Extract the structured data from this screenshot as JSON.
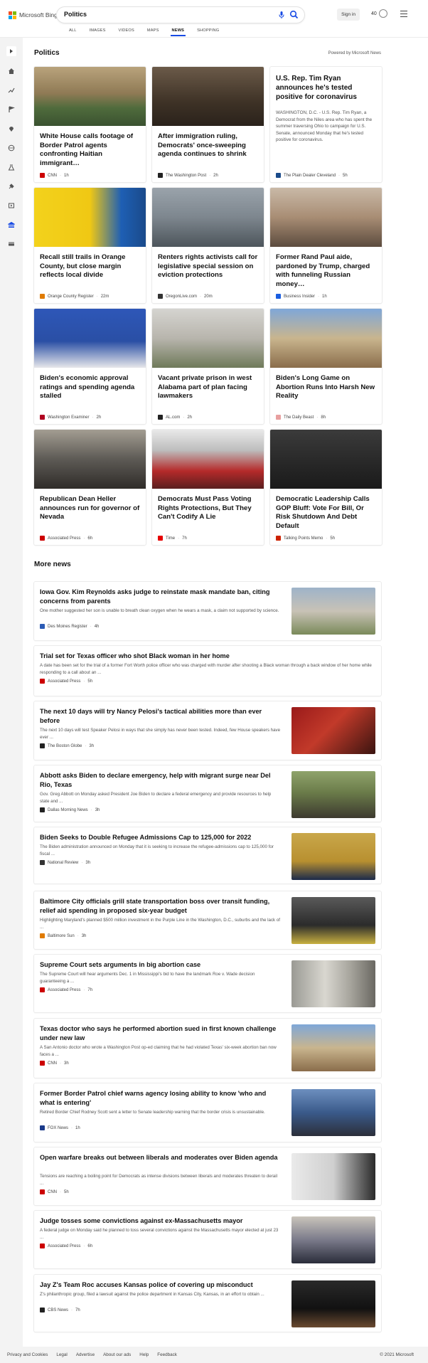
{
  "header": {
    "brand": "Microsoft Bing",
    "query": "Politics",
    "sign_in": "Sign in",
    "rewards_points": "40",
    "icons": [
      "microphone-icon",
      "search-icon",
      "rewards-medal-icon",
      "hamburger-menu-icon"
    ],
    "tabs": [
      {
        "label": "ALL",
        "active": false
      },
      {
        "label": "IMAGES",
        "active": false
      },
      {
        "label": "VIDEOS",
        "active": false
      },
      {
        "label": "MAPS",
        "active": false
      },
      {
        "label": "NEWS",
        "active": true
      },
      {
        "label": "SHOPPING",
        "active": false
      }
    ],
    "colors": {
      "accent": "#174ae4",
      "ms_red": "#f25022",
      "ms_green": "#7fba00",
      "ms_blue": "#00a4ef",
      "ms_yellow": "#ffb900"
    }
  },
  "sidebar": {
    "icons": [
      "expand-icon",
      "home-icon",
      "trending-icon",
      "flag-icon",
      "location-icon",
      "world-icon",
      "science-icon",
      "sports-icon",
      "entertainment-icon",
      "politics-icon",
      "money-icon"
    ]
  },
  "section": {
    "title": "Politics",
    "powered_by": "Powered by Microsoft News"
  },
  "cards": [
    {
      "title": "White House calls footage of Border Patrol agents confronting Haitian immigrant…",
      "source": "CNN",
      "time": "1h",
      "favicon_color": "#cc0000",
      "image": "border-patrol-horse-photo"
    },
    {
      "title": "After immigration ruling, Democrats' once-sweeping agenda continues to shrink",
      "source": "The Washington Post",
      "time": "2h",
      "favicon_color": "#222222",
      "image": "senators-hallway-photo"
    },
    {
      "title": "U.S. Rep. Tim Ryan announces he's tested positive for coronavirus",
      "snippet": "WASHINGTON, D.C. - U.S. Rep. Tim Ryan, a Democrat from the Niles area who has spent the summer traversing Ohio to campaign for U.S. Senate, announced Monday that he's tested positive for coronavirus.",
      "source": "The Plain Dealer Cleveland",
      "time": "5h",
      "favicon_color": "#1a4a8a"
    },
    {
      "title": "Recall still trails in Orange County, but close margin reflects local divide",
      "source": "Orange County Register",
      "time": "22m",
      "favicon_color": "#e07b00",
      "image": "ballot-drop-box-photo"
    },
    {
      "title": "Renters rights activists call for legislative special session on eviction protections",
      "source": "OregonLive.com",
      "time": "20m",
      "favicon_color": "#333333",
      "image": "capitol-dome-photo"
    },
    {
      "title": "Former Rand Paul aide, pardoned by Trump, charged with funneling Russian money…",
      "source": "Business Insider",
      "time": "1h",
      "favicon_color": "#1a5ee0",
      "image": "aide-portrait-photo"
    },
    {
      "title": "Biden's economic approval ratings and spending agenda stalled",
      "source": "Washington Examiner",
      "time": "2h",
      "favicon_color": "#b00020",
      "image": "pelosi-biden-podium-photo"
    },
    {
      "title": "Vacant private prison in west Alabama part of plan facing lawmakers",
      "source": "AL.com",
      "time": "2h",
      "favicon_color": "#222222",
      "image": "pardons-paroles-sign-photo"
    },
    {
      "title": "Biden's Long Game on Abortion Runs Into Harsh New Reality",
      "source": "The Daily Beast",
      "time": "8h",
      "favicon_color": "#e8a0a0",
      "image": "texas-protest-photo"
    },
    {
      "title": "Republican Dean Heller announces run for governor of Nevada",
      "source": "Associated Press",
      "time": "6h",
      "favicon_color": "#cc0000",
      "image": "heller-rally-photo"
    },
    {
      "title": "Democrats Must Pass Voting Rights Protections, But They Can't Codify A Lie",
      "source": "Time",
      "time": "7h",
      "favicon_color": "#e60000",
      "image": "voting-rights-rally-photo"
    },
    {
      "title": "Democratic Leadership Calls GOP Bluff: Vote For Bill, Or Risk Shutdown And Debt Default",
      "source": "Talking Points Memo",
      "time": "5h",
      "favicon_color": "#cc2200",
      "image": "democratic-leaders-photo"
    }
  ],
  "more_news": {
    "title": "More news",
    "items": [
      {
        "title": "Iowa Gov. Kim Reynolds asks judge to reinstate mask mandate ban, citing concerns from parents",
        "snippet": "One mother suggested her son is unable to breath clean oxygen when he wears a mask, a claim not supported by science.",
        "source": "Des Moines Register",
        "time": "4h",
        "favicon_color": "#2b5bb5",
        "has_thumb": true
      },
      {
        "title": "Trial set for Texas officer who shot Black woman in her home",
        "snippet": "A date has been set for the trial of a former Fort Worth police officer who was charged with murder after shooting a Black woman through a back window of her home while responding to a call about an ...",
        "source": "Associated Press",
        "time": "5h",
        "favicon_color": "#cc0000",
        "has_thumb": false
      },
      {
        "title": "The next 10 days will try Nancy Pelosi's tactical abilities more than ever before",
        "snippet": "The next 10 days will test Speaker Pelosi in ways that she simply has never been tested. Indeed, few House speakers have ever ...",
        "source": "The Boston Globe",
        "time": "3h",
        "favicon_color": "#222222",
        "has_thumb": true
      },
      {
        "title": "Abbott asks Biden to declare emergency, help with migrant surge near Del Rio, Texas",
        "snippet": "Gov. Greg Abbott on Monday asked President Joe Biden to declare a federal emergency and provide resources to help state and ...",
        "source": "Dallas Morning News",
        "time": "3h",
        "favicon_color": "#222222",
        "has_thumb": true
      },
      {
        "title": "Biden Seeks to Double Refugee Admissions Cap to 125,000 for 2022",
        "snippet": "The Biden administration announced on Monday that it is seeking to increase the refugee-admissions cap to 125,000 for fiscal ...",
        "source": "National Review",
        "time": "3h",
        "favicon_color": "#333333",
        "has_thumb": true
      },
      {
        "title": "Baltimore City officials grill state transportation boss over transit funding, relief aid spending in proposed six-year budget",
        "snippet": "Highlighting Maryland's planned $500 million investment in the Purple Line in the Washington, D.C., suburbs and the lack of ...",
        "source": "Baltimore Sun",
        "time": "3h",
        "favicon_color": "#e07b00",
        "has_thumb": true
      },
      {
        "title": "Supreme Court sets arguments in big abortion case",
        "snippet": "The Supreme Court will hear arguments Dec. 1 in Mississippi's bid to have the landmark Roe v. Wade decision guaranteeing a ...",
        "source": "Associated Press",
        "time": "7h",
        "favicon_color": "#cc0000",
        "has_thumb": true
      },
      {
        "title": "Texas doctor who says he performed abortion sued in first known challenge under new law",
        "snippet": "A San Antonio doctor who wrote a Washington Post op-ed claiming that he had violated Texas' six-week abortion ban now faces a ...",
        "source": "CNN",
        "time": "3h",
        "favicon_color": "#cc0000",
        "has_thumb": true
      },
      {
        "title": "Former Border Patrol chief warns agency losing ability to know 'who and what is entering'",
        "snippet": "Retired Border Chief Rodney Scott sent a letter to Senate leadership warning that the border crisis is unsustainable.",
        "source": "FOX News",
        "time": "1h",
        "favicon_color": "#1a3a8a",
        "has_thumb": true
      },
      {
        "title": "Open warfare breaks out between liberals and moderates over Biden agenda",
        "snippet": "Tensions are reaching a boiling point for Democrats as intense divisions between liberals and moderates threaten to derail ...",
        "source": "CNN",
        "time": "5h",
        "favicon_color": "#cc0000",
        "has_thumb": true
      },
      {
        "title": "Judge tosses some convictions against ex-Massachusetts mayor",
        "snippet": "A federal judge on Monday said he planned to toss several convictions against the Massachusetts mayor elected at just 23 ...",
        "source": "Associated Press",
        "time": "6h",
        "favicon_color": "#cc0000",
        "has_thumb": true
      },
      {
        "title": "Jay Z's Team Roc accuses Kansas police of covering up misconduct",
        "snippet": "Z's philanthropic group, filed a lawsuit against the police department in Kansas City, Kansas, in an effort to obtain ...",
        "source": "CBS News",
        "time": "7h",
        "favicon_color": "#222222",
        "has_thumb": true
      }
    ]
  },
  "footer": {
    "links": [
      "Privacy and Cookies",
      "Legal",
      "Advertise",
      "About our ads",
      "Help",
      "Feedback"
    ],
    "copyright": "© 2021 Microsoft"
  }
}
